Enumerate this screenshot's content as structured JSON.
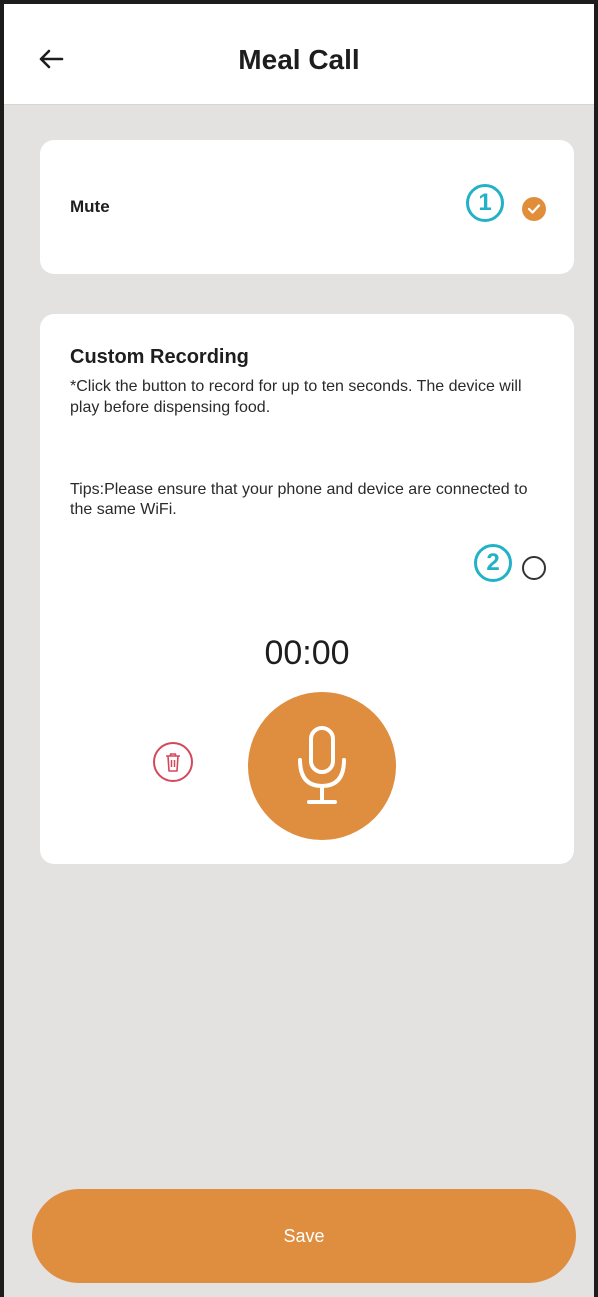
{
  "header": {
    "title": "Meal Call",
    "back_icon": "arrow-left-icon"
  },
  "mute": {
    "label": "Mute",
    "selected": true,
    "badge": "1"
  },
  "custom_recording": {
    "title": "Custom Recording",
    "description": "*Click the button to record for up to ten seconds. The device will play before dispensing food.",
    "tips": "Tips:Please ensure that your phone and device are connected to the same WiFi.",
    "selected": false,
    "badge": "2",
    "timer": "00:00",
    "delete_icon": "trash-icon",
    "mic_icon": "microphone-icon"
  },
  "footer": {
    "save_label": "Save"
  },
  "colors": {
    "accent": "#df8d3e",
    "badge": "#22b1c6",
    "delete": "#d3485a",
    "background": "#e4e1e1"
  }
}
